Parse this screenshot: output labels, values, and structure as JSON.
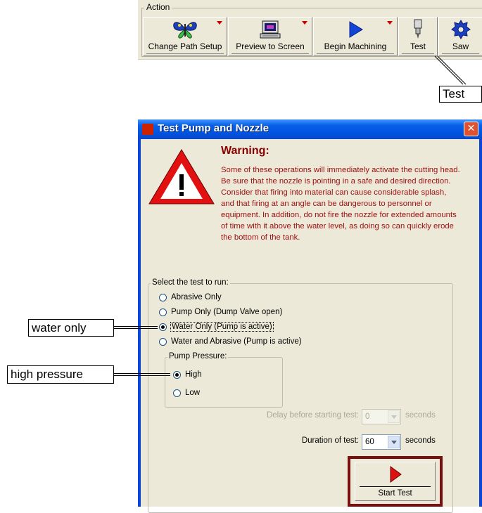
{
  "toolbar": {
    "group_label": "Action",
    "buttons": [
      {
        "label": "Change Path Setup",
        "icon": "butterfly-icon",
        "has_dropdown": true
      },
      {
        "label": "Preview to Screen",
        "icon": "monitor-icon",
        "has_dropdown": true
      },
      {
        "label": "Begin Machining",
        "icon": "play-icon",
        "has_dropdown": true
      },
      {
        "label": "Test",
        "icon": "nozzle-icon",
        "has_dropdown": false
      },
      {
        "label": "Saw",
        "icon": "saw-blade-icon",
        "has_dropdown": false
      }
    ]
  },
  "callouts": {
    "test": "Test",
    "water_only": "water only",
    "high_pressure": "high pressure"
  },
  "dialog": {
    "title": "Test Pump and Nozzle",
    "warning_title": "Warning:",
    "warning_text": "Some of these operations will immediately activate the cutting head. Be sure that the nozzle is pointing in a safe and desired direction.  Consider that firing into material can cause considerable splash, and that firing at an angle can be dangerous to personnel or equipment. In addition, do not fire the nozzle for extended amounts of time with it above the water level, as doing so can quickly erode the bottom of the tank.",
    "test_group_label": "Select the test to run:",
    "tests": [
      {
        "label": "Abrasive Only",
        "selected": false
      },
      {
        "label": "Pump Only (Dump Valve open)",
        "selected": false
      },
      {
        "label": "Water Only (Pump is active)",
        "selected": true
      },
      {
        "label": "Water and Abrasive (Pump is active)",
        "selected": false
      }
    ],
    "pressure_group_label": "Pump Pressure:",
    "pressures": [
      {
        "label": "High",
        "selected": true
      },
      {
        "label": "Low",
        "selected": false
      }
    ],
    "delay": {
      "label": "Delay before starting test:",
      "value": "0",
      "unit": "seconds",
      "enabled": false
    },
    "duration": {
      "label": "Duration of test:",
      "value": "60",
      "unit": "seconds",
      "enabled": true
    },
    "start_button": "Start Test",
    "colors": {
      "warning": "#a01010",
      "title_bar": "#0a5fe8",
      "start_frame": "#7a0f0f"
    }
  }
}
